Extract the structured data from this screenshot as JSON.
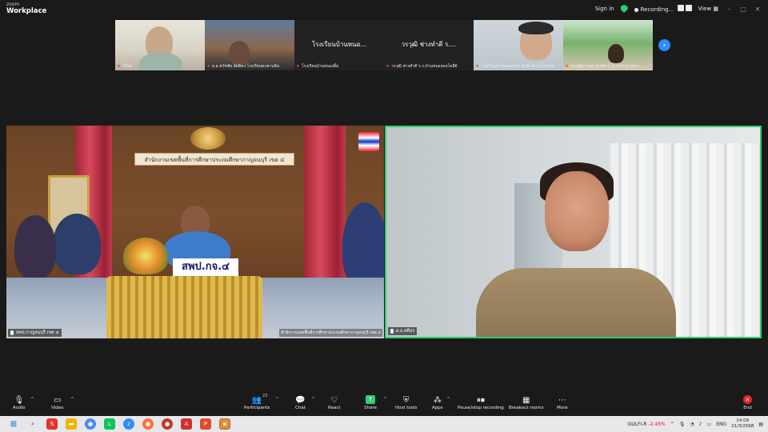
{
  "app": {
    "brand_top": "zoom",
    "brand_name": "Workplace"
  },
  "titlebar": {
    "sign_in": "Sign in",
    "recording": "Recording...",
    "view": "View"
  },
  "thumbnails": [
    {
      "caption": "ก็Nok",
      "display_name": ""
    },
    {
      "caption": "ผ.อ.ชวัชชัย สัตติคง โรงเรียนตะพานหิน",
      "display_name": ""
    },
    {
      "caption": "โรงเรียนบ้านหนองยิ้ม",
      "display_name": "โรงเรียนบ้านหนอ..."
    },
    {
      "caption": "วรวุฒิ ช่างทำดี ร.ร.บ้านหนองคอโคสีย์",
      "display_name": "วรวุฒิ ช่างทำดี ร...."
    },
    {
      "caption": "โรงเรียนบ้านหนองแซ่ะ ภักดี เสนาโรงเรียน",
      "display_name": ""
    },
    {
      "caption": "ของณัฐกานต์ กุลคติกร์ โรงเรียนบ้านเขา",
      "display_name": ""
    }
  ],
  "videos": {
    "left": {
      "caption": "สพป.กาญจนบุรี เขต ๔",
      "banner": "สำนักงานเขตพื้นที่การศึกษาประถมศึกษากาญจนบุรี เขต ๔",
      "nameplate": "สพป.กจ.๔",
      "watermark": "สำนักงานเขตพื้นที่การศึกษาประถมศึกษากาญจนบุรี เขต ๔"
    },
    "right": {
      "caption": "ผ.อ.สตีอร"
    }
  },
  "toolbar": {
    "audio": "Audio",
    "video": "Video",
    "participants": "Participants",
    "participants_count": "23",
    "chat": "Chat",
    "react": "React",
    "share": "Share",
    "host_tools": "Host tools",
    "apps": "Apps",
    "pause_stop_recording": "Pause/stop recording",
    "breakout_rooms": "Breakout rooms",
    "more": "More",
    "end": "End"
  },
  "taskbar": {
    "stock_name": "GULFI-R",
    "stock_change": "-2.45%",
    "language": "ENG",
    "time": "14:09",
    "date": "21/3/2568"
  },
  "colors": {
    "accent": "#2d8cff",
    "active_speaker": "#2ecc71",
    "end_red": "#e02828"
  }
}
